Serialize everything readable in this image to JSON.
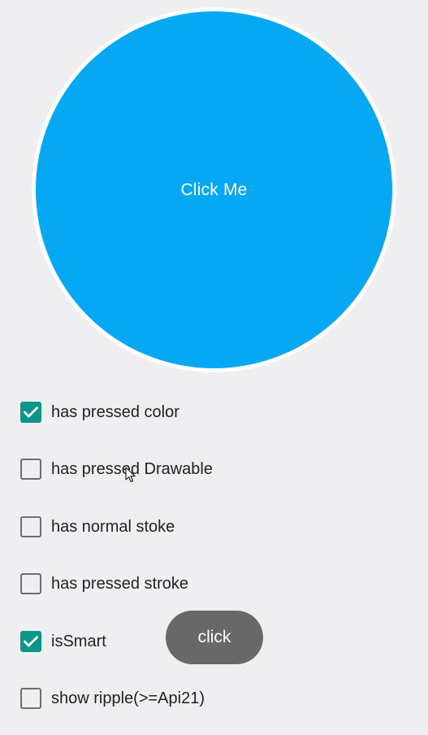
{
  "main_button": {
    "label": "Click Me",
    "fill_color": "#06a8f3",
    "ring_color": "#ffffff"
  },
  "options": [
    {
      "label": "has pressed color",
      "checked": true
    },
    {
      "label": "has pressed Drawable",
      "checked": false
    },
    {
      "label": "has normal stoke",
      "checked": false
    },
    {
      "label": "has pressed stroke",
      "checked": false
    },
    {
      "label": "isSmart",
      "checked": true
    },
    {
      "label": "show ripple(>=Api21)",
      "checked": false
    }
  ],
  "secondary_button": {
    "label": "click",
    "fill_color": "#686868"
  },
  "colors": {
    "background": "#efeef1",
    "checkbox_checked": "#0a9688",
    "checkbox_unchecked": "#6d6d6d"
  },
  "icons": {
    "checkbox_check": "check-icon",
    "pointer": "mouse-cursor-icon"
  }
}
